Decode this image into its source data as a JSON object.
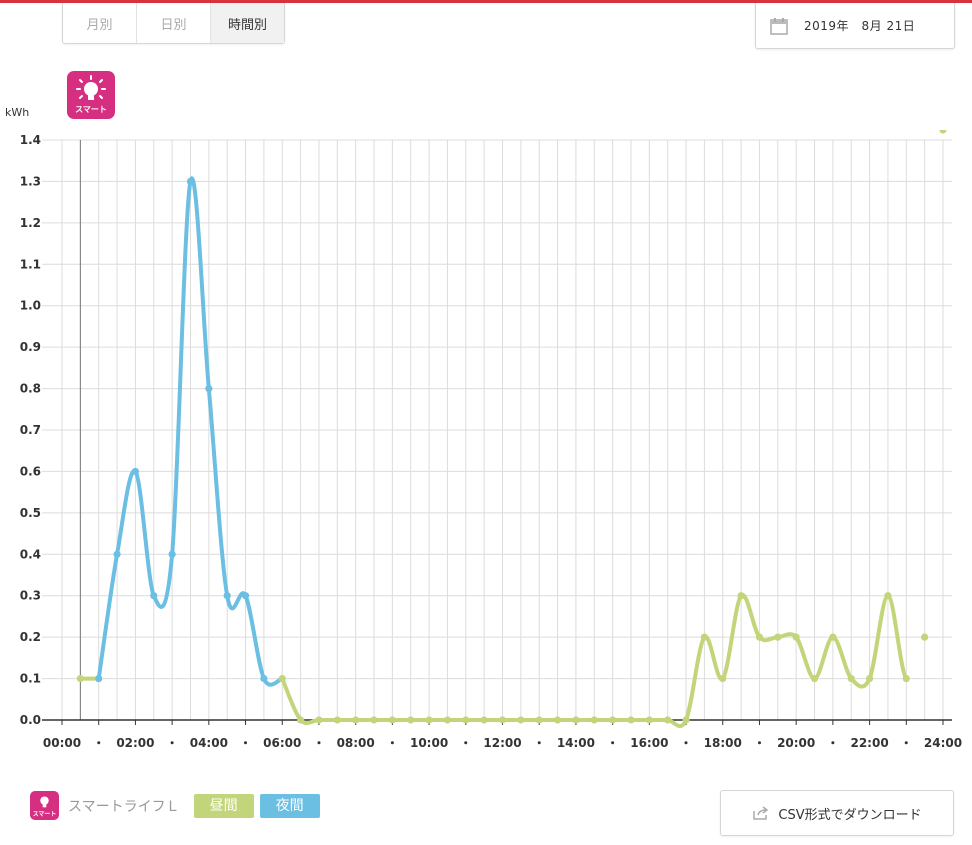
{
  "tabs": [
    {
      "label": "月別",
      "active": false
    },
    {
      "label": "日別",
      "active": false
    },
    {
      "label": "時間別",
      "active": true
    }
  ],
  "date": {
    "text": "2019年　8月 21日"
  },
  "badge": {
    "label": "スマート",
    "icon": "lightbulb-icon"
  },
  "legend": {
    "name": "スマートライフＬ",
    "day_label": "昼間",
    "night_label": "夜間"
  },
  "csv": {
    "label": "CSV形式でダウンロード",
    "icon": "export-icon"
  },
  "colors": {
    "accent": "#d7333e",
    "brand": "#d62f82",
    "day": "#c3d57a",
    "night": "#6bbfe2"
  },
  "chart_data": {
    "type": "line",
    "ylabel": "kWh",
    "ylim": [
      0,
      1.4
    ],
    "yticks": [
      "0.0",
      "0.1",
      "0.2",
      "0.3",
      "0.4",
      "0.5",
      "0.6",
      "0.7",
      "0.8",
      "0.9",
      "1.0",
      "1.1",
      "1.2",
      "1.3",
      "1.4"
    ],
    "xticks": [
      "00:00",
      "・",
      "02:00",
      "・",
      "04:00",
      "・",
      "06:00",
      "・",
      "08:00",
      "・",
      "10:00",
      "・",
      "12:00",
      "・",
      "14:00",
      "・",
      "16:00",
      "・",
      "18:00",
      "・",
      "20:00",
      "・",
      "22:00",
      "・",
      "24:00"
    ],
    "x_range_hours": [
      0,
      24
    ],
    "grid": true,
    "x": [
      "00:30",
      "01:00",
      "01:30",
      "02:00",
      "02:30",
      "03:00",
      "03:30",
      "04:00",
      "04:30",
      "05:00",
      "05:30",
      "06:00",
      "06:30",
      "07:00",
      "07:30",
      "08:00",
      "08:30",
      "09:00",
      "09:30",
      "10:00",
      "10:30",
      "11:00",
      "11:30",
      "12:00",
      "12:30",
      "13:00",
      "13:30",
      "14:00",
      "14:30",
      "15:00",
      "15:30",
      "16:00",
      "16:30",
      "17:00",
      "17:30",
      "18:00",
      "18:30",
      "19:00",
      "19:30",
      "20:00",
      "20:30",
      "21:00",
      "21:30",
      "22:00",
      "22:30",
      "23:00",
      "23:30",
      "24:00"
    ],
    "values": [
      0.1,
      0.1,
      0.4,
      0.6,
      0.3,
      0.4,
      1.3,
      0.8,
      0.3,
      0.3,
      0.1,
      0.1,
      0.0,
      0.0,
      0.0,
      0.0,
      0.0,
      0.0,
      0.0,
      0.0,
      0.0,
      0.0,
      0.0,
      0.0,
      0.0,
      0.0,
      0.0,
      0.0,
      0.0,
      0.0,
      0.0,
      0.0,
      0.0,
      0.0,
      0.2,
      0.1,
      0.3,
      0.2,
      0.2,
      0.2,
      0.1,
      0.2,
      0.1,
      0.1,
      0.3,
      0.1,
      0.2
    ],
    "series": [
      {
        "name": "夜間",
        "color": "#6bbfe2",
        "time_range": [
          "00:30",
          "06:00"
        ]
      },
      {
        "name": "昼間",
        "color": "#c3d57a",
        "time_range": [
          "06:00",
          "24:00"
        ]
      }
    ]
  }
}
